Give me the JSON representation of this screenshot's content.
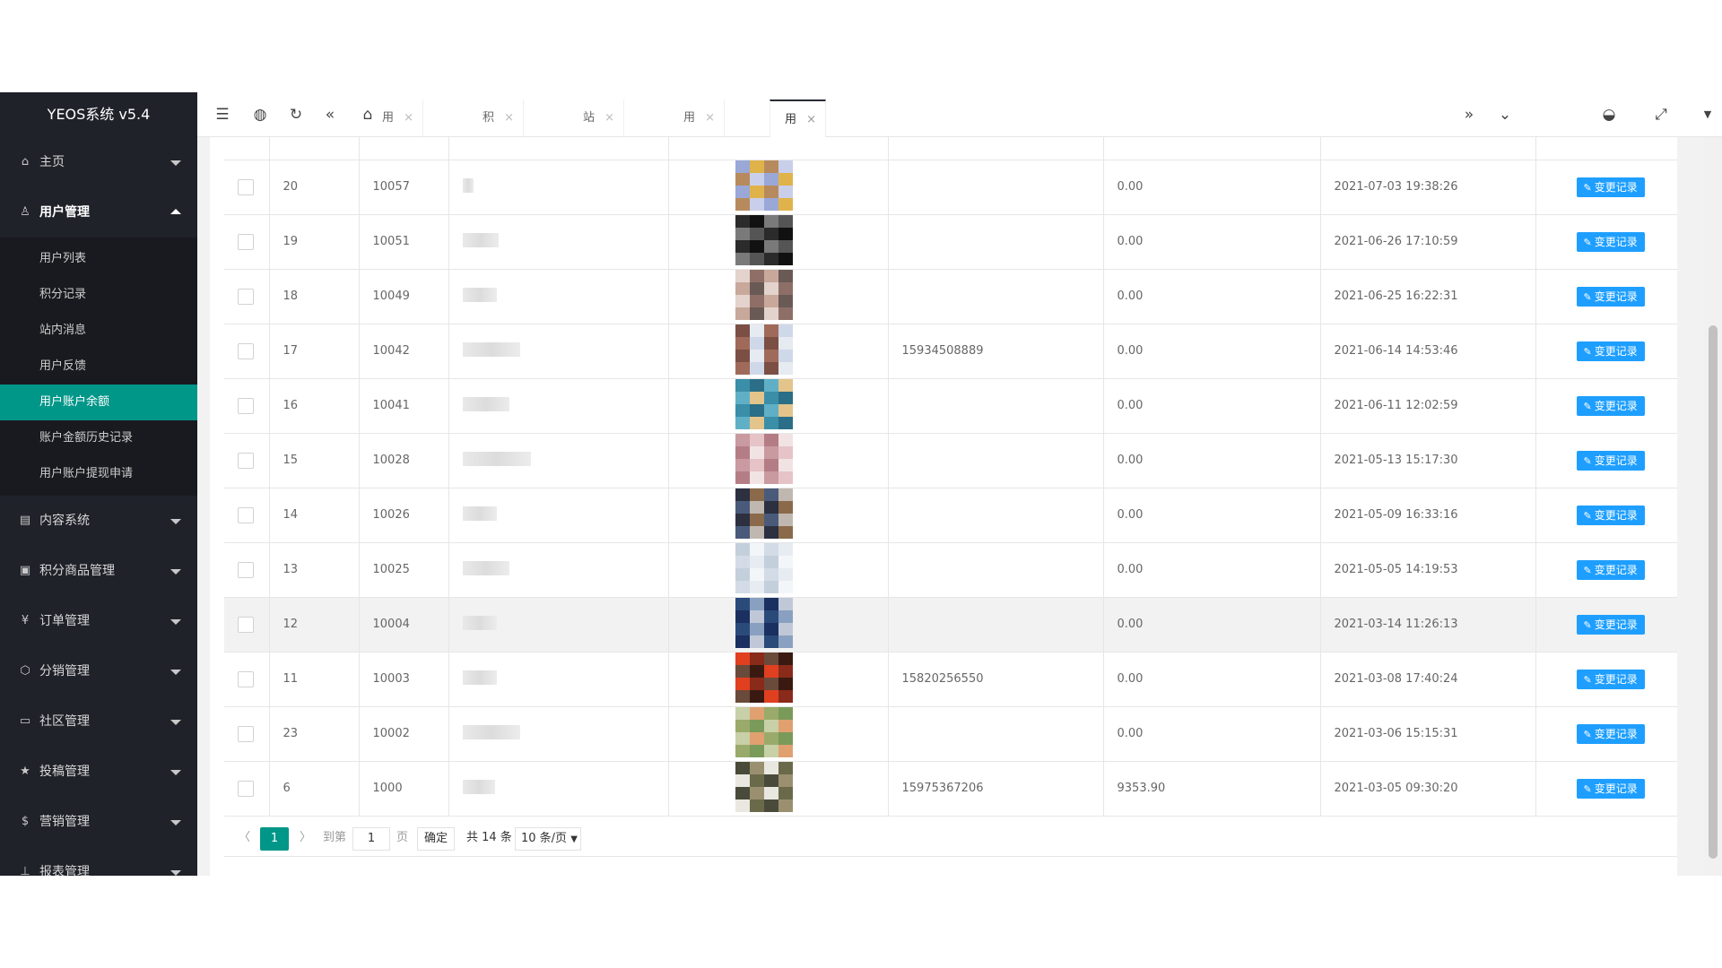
{
  "app": {
    "title": "YEOS系统 v5.4"
  },
  "sidebar": {
    "items": [
      {
        "label": "主页",
        "icon": "⌂",
        "open": false
      },
      {
        "label": "用户管理",
        "icon": "♙",
        "open": true
      },
      {
        "label": "内容系统",
        "icon": "▤",
        "open": false
      },
      {
        "label": "积分商品管理",
        "icon": "▣",
        "open": false
      },
      {
        "label": "订单管理",
        "icon": "¥",
        "open": false
      },
      {
        "label": "分销管理",
        "icon": "⬡",
        "open": false
      },
      {
        "label": "社区管理",
        "icon": "▭",
        "open": false
      },
      {
        "label": "投稿管理",
        "icon": "★",
        "open": false
      },
      {
        "label": "营销管理",
        "icon": "$",
        "open": false
      },
      {
        "label": "报表管理",
        "icon": "⊥",
        "open": false
      }
    ],
    "submenu": [
      {
        "label": "用户列表"
      },
      {
        "label": "积分记录"
      },
      {
        "label": "站内消息"
      },
      {
        "label": "用户反馈"
      },
      {
        "label": "用户账户余额",
        "active": true
      },
      {
        "label": "账户金额历史记录"
      },
      {
        "label": "用户账户提现申请"
      }
    ],
    "active_color": "#009688"
  },
  "header": {
    "icons": [
      "menu-collapse-icon",
      "globe-icon",
      "refresh-icon",
      "double-left-icon",
      "home-icon"
    ],
    "tabs": [
      {
        "label": "用户列表",
        "close": "×"
      },
      {
        "label": "积分记录",
        "close": "×"
      },
      {
        "label": "站内消息",
        "close": "×"
      },
      {
        "label": "用户反馈",
        "close": "×"
      },
      {
        "label": "用户账户余额",
        "close": "×",
        "active": true
      }
    ],
    "right_icons": [
      "double-right-icon",
      "chevron-down-icon",
      "theme-icon",
      "fullscreen-icon",
      "more-icon"
    ]
  },
  "table": {
    "button_label": "变更记录",
    "button_color": "#1e9fff",
    "rows": [
      {
        "no": "20",
        "uid": "10057",
        "phone": "",
        "balance": "0.00",
        "time": "2021-07-03 19:38:26"
      },
      {
        "no": "19",
        "uid": "10051",
        "phone": "",
        "balance": "0.00",
        "time": "2021-06-26 17:10:59"
      },
      {
        "no": "18",
        "uid": "10049",
        "phone": "",
        "balance": "0.00",
        "time": "2021-06-25 16:22:31"
      },
      {
        "no": "17",
        "uid": "10042",
        "phone": "15934508889",
        "balance": "0.00",
        "time": "2021-06-14 14:53:46"
      },
      {
        "no": "16",
        "uid": "10041",
        "phone": "",
        "balance": "0.00",
        "time": "2021-06-11 12:02:59"
      },
      {
        "no": "15",
        "uid": "10028",
        "phone": "",
        "balance": "0.00",
        "time": "2021-05-13 15:17:30"
      },
      {
        "no": "14",
        "uid": "10026",
        "phone": "",
        "balance": "0.00",
        "time": "2021-05-09 16:33:16"
      },
      {
        "no": "13",
        "uid": "10025",
        "phone": "",
        "balance": "0.00",
        "time": "2021-05-05 14:19:53"
      },
      {
        "no": "12",
        "uid": "10004",
        "phone": "",
        "balance": "0.00",
        "time": "2021-03-14 11:26:13",
        "highlight": true
      },
      {
        "no": "11",
        "uid": "10003",
        "phone": "15820256550",
        "balance": "0.00",
        "time": "2021-03-08 17:40:24"
      },
      {
        "no": "23",
        "uid": "10002",
        "phone": "",
        "balance": "0.00",
        "time": "2021-03-06 15:15:31"
      },
      {
        "no": "6",
        "uid": "1000",
        "phone": "15975367206",
        "balance": "9353.90",
        "time": "2021-03-05 09:30:20"
      }
    ]
  },
  "pagination": {
    "prev": "〈",
    "current": "1",
    "next": "〉",
    "goto_label": "到第",
    "page_input": "1",
    "page_unit": "页",
    "confirm": "确定",
    "total": "共 14 条",
    "page_size": "10 条/页"
  }
}
